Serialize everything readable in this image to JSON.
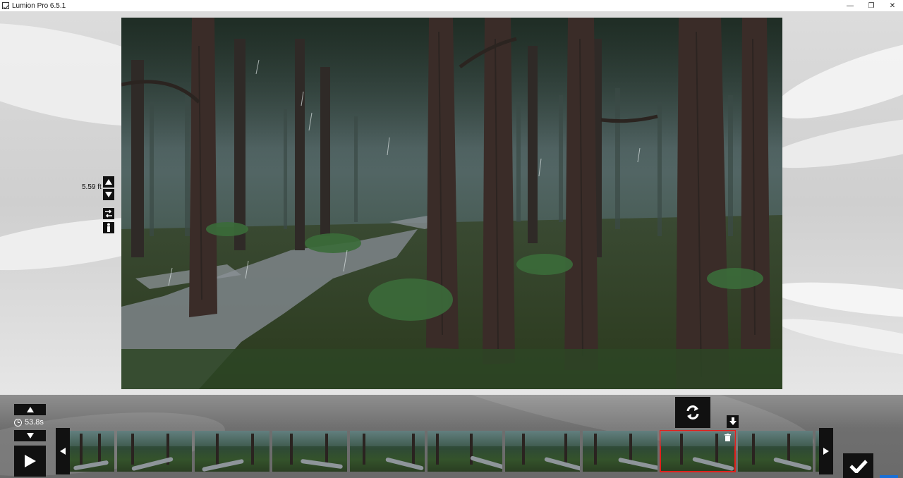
{
  "window": {
    "title": "Lumion Pro 6.5.1",
    "minimize_glyph": "—",
    "restore_glyph": "❐",
    "close_glyph": "✕"
  },
  "camera": {
    "height_label": "5.59 ft"
  },
  "timeline": {
    "duration": "53.8s",
    "selected_clip_index": 8,
    "clip_count": 10
  },
  "colors": {
    "selection": "#e0201c",
    "accent_blue": "#1a6fd6"
  },
  "icons": {
    "refresh": "refresh-icon",
    "download": "arrow-down-icon",
    "confirm": "checkmark-icon",
    "delete": "trash-icon"
  }
}
